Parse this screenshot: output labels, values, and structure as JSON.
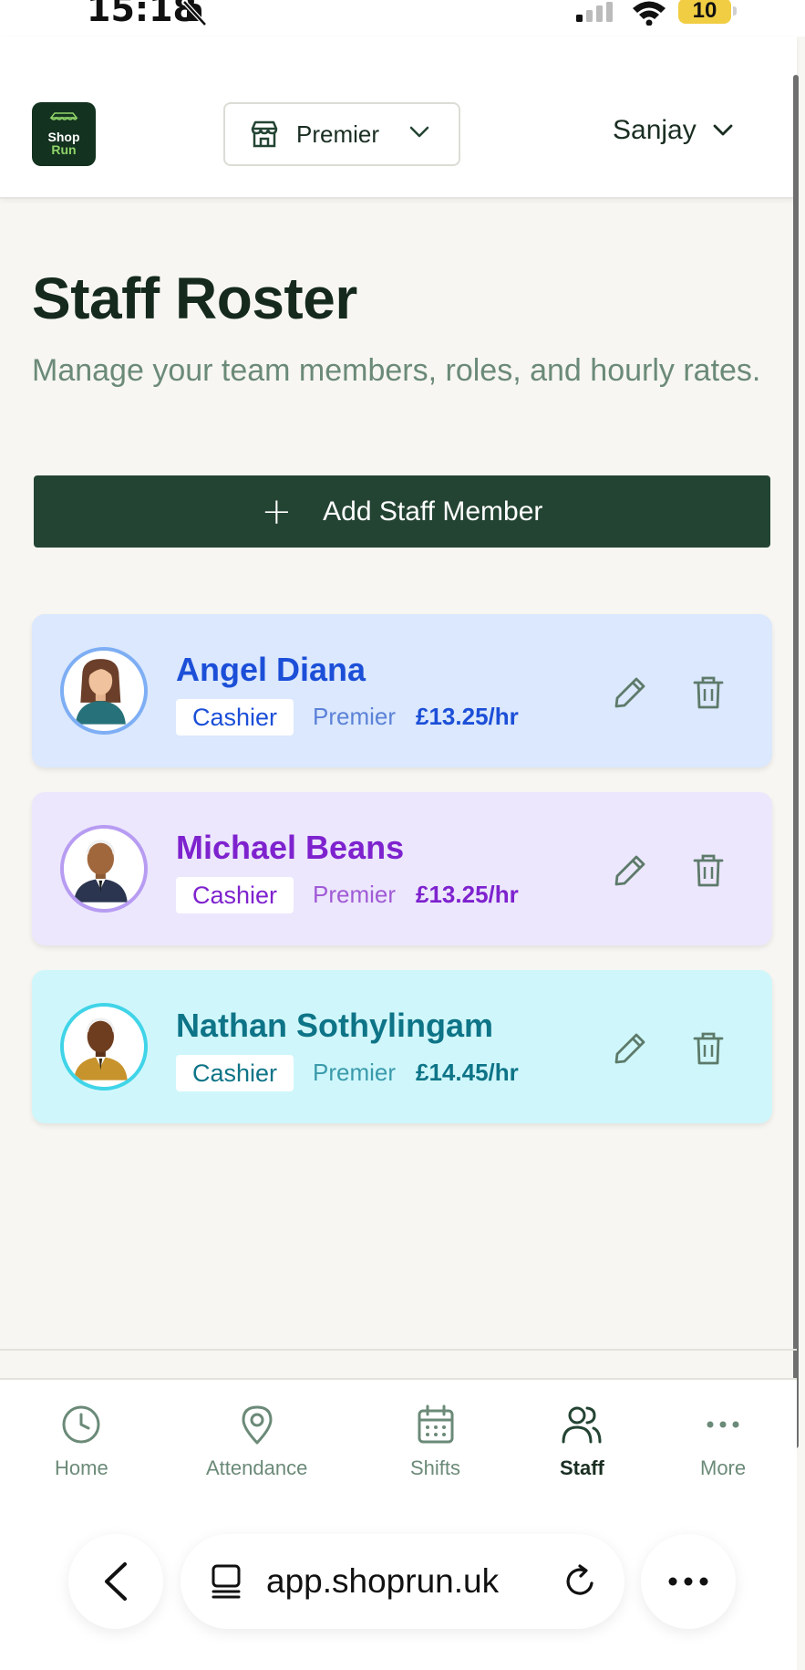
{
  "status_bar": {
    "time": "15:18",
    "battery": "10"
  },
  "header": {
    "logo_line1": "Shop",
    "logo_line2": "Run",
    "store_selector": "Premier",
    "user_menu": "Sanjay"
  },
  "main": {
    "title": "Staff Roster",
    "subtitle": "Manage your team members, roles, and hourly rates.",
    "add_button": "Add Staff Member",
    "staff": [
      {
        "name": "Angel Diana",
        "role": "Cashier",
        "store": "Premier",
        "rate": "£13.25/hr"
      },
      {
        "name": "Michael Beans",
        "role": "Cashier",
        "store": "Premier",
        "rate": "£13.25/hr"
      },
      {
        "name": "Nathan Sothylingam",
        "role": "Cashier",
        "store": "Premier",
        "rate": "£14.45/hr"
      }
    ]
  },
  "bottom_nav": {
    "items": [
      {
        "label": "Home",
        "icon": "clock-icon"
      },
      {
        "label": "Attendance",
        "icon": "map-pin-icon"
      },
      {
        "label": "Shifts",
        "icon": "calendar-icon"
      },
      {
        "label": "Staff",
        "icon": "users-icon",
        "active": true
      },
      {
        "label": "More",
        "icon": "more-horizontal-icon"
      }
    ]
  },
  "browser": {
    "url": "app.shoprun.uk"
  },
  "colors": {
    "brand_dark": "#244433",
    "blue": "#1c4fd8",
    "purple": "#7e22ce",
    "teal": "#0e7487"
  }
}
